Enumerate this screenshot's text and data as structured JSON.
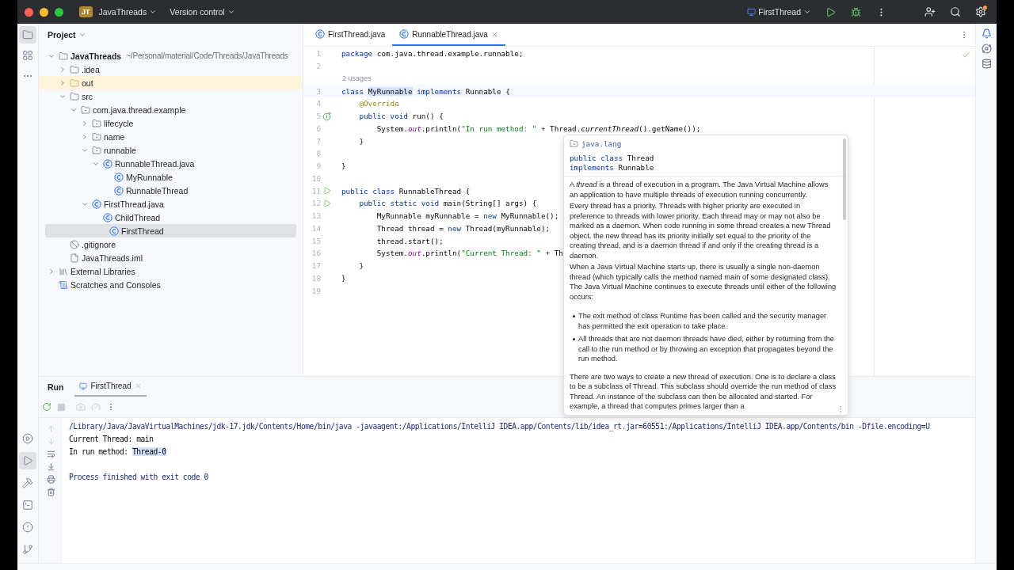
{
  "title_bar": {
    "project_badge": "JT",
    "project": "JavaThreads",
    "vcs": "Version control",
    "run_config": "FirstThread"
  },
  "left_tools": [
    {
      "kind": "project",
      "selected": true
    },
    {
      "kind": "structure",
      "selected": false
    },
    {
      "kind": "more",
      "selected": false
    }
  ],
  "left_tools_bottom": [
    {
      "kind": "services",
      "selected": false
    },
    {
      "kind": "run",
      "selected": true
    },
    {
      "kind": "build",
      "selected": false
    },
    {
      "kind": "terminal",
      "selected": false
    },
    {
      "kind": "problems",
      "selected": false
    },
    {
      "kind": "git",
      "selected": false
    }
  ],
  "project": {
    "title": "Project",
    "tree": [
      {
        "kind": "module",
        "label": "JavaThreads",
        "path": "~/Personal/material/Code/Threads/JavaThreads",
        "expanded": true,
        "selected": false,
        "children": [
          {
            "kind": "folder",
            "label": ".idea",
            "expanded": false,
            "selected": false
          },
          {
            "kind": "excluded-folder",
            "label": "out",
            "expanded": false,
            "selected": false
          },
          {
            "kind": "folder",
            "label": "src",
            "expanded": true,
            "selected": false,
            "children": [
              {
                "kind": "package",
                "label": "com.java.thread.example",
                "expanded": true,
                "selected": false,
                "children": [
                  {
                    "kind": "package",
                    "label": "lifecycle",
                    "expanded": false,
                    "selected": false
                  },
                  {
                    "kind": "package",
                    "label": "name",
                    "expanded": false,
                    "selected": false
                  },
                  {
                    "kind": "package",
                    "label": "runnable",
                    "expanded": true,
                    "selected": false,
                    "children": [
                      {
                        "kind": "class",
                        "label": "RunnableThread.java",
                        "expanded": true,
                        "selected": false,
                        "children": [
                          {
                            "kind": "class",
                            "label": "MyRunnable",
                            "selected": false
                          },
                          {
                            "kind": "class",
                            "label": "RunnableThread",
                            "selected": false
                          }
                        ]
                      }
                    ]
                  },
                  {
                    "kind": "class",
                    "label": "FirstThread.java",
                    "expanded": true,
                    "selected": false,
                    "children": [
                      {
                        "kind": "class",
                        "label": "ChildThread",
                        "selected": false
                      },
                      {
                        "kind": "class",
                        "label": "FirstThread",
                        "selected": true
                      }
                    ]
                  }
                ]
              }
            ]
          },
          {
            "kind": "ignore",
            "label": ".gitignore",
            "selected": false
          },
          {
            "kind": "file",
            "label": "JavaThreads.iml",
            "selected": false
          }
        ]
      },
      {
        "kind": "libraries",
        "label": "External Libraries",
        "expanded": false,
        "selected": false
      },
      {
        "kind": "scratches",
        "label": "Scratches and Consoles",
        "selected": false
      }
    ]
  },
  "editor": {
    "tabs": [
      {
        "label": "FirstThread.java",
        "selected": false
      },
      {
        "label": "RunnableThread.java",
        "selected": true
      }
    ],
    "lines": [
      {
        "kind": "code",
        "number": "1",
        "current": false,
        "segments": [
          {
            "kind": "kw",
            "text": "package"
          },
          {
            "kind": "plain",
            "text": " com.java.thread.example.runnable;"
          }
        ]
      },
      {
        "kind": "code",
        "number": "2",
        "current": false
      },
      {
        "kind": "inlay",
        "text": "2 usages"
      },
      {
        "kind": "code",
        "number": "3",
        "current": true,
        "segments": [
          {
            "kind": "kw",
            "text": "class "
          },
          {
            "kind": "selection",
            "text": "MyRunnable"
          },
          {
            "kind": "kw",
            "text": " implements"
          },
          {
            "kind": "plain",
            "text": " Runnable {"
          }
        ]
      },
      {
        "kind": "code",
        "number": "4",
        "current": false,
        "segments": [
          {
            "kind": "ann",
            "text": "    @Override"
          }
        ]
      },
      {
        "kind": "code",
        "number": "5",
        "current": false,
        "gutter_icon": {
          "kind": "override"
        },
        "segments": [
          {
            "kind": "kw",
            "text": "    public void"
          },
          {
            "kind": "plain",
            "text": " run() {"
          }
        ]
      },
      {
        "kind": "code",
        "number": "6",
        "current": false,
        "segments": [
          {
            "kind": "plain",
            "text": "        System."
          },
          {
            "kind": "field",
            "text": "out"
          },
          {
            "kind": "plain",
            "text": ".println("
          },
          {
            "kind": "str",
            "text": "\"In run method: \""
          },
          {
            "kind": "plain",
            "text": " + Thread."
          },
          {
            "kind": "call",
            "text": "currentThread"
          },
          {
            "kind": "plain",
            "text": "().getName());"
          }
        ]
      },
      {
        "kind": "code",
        "number": "7",
        "current": false,
        "segments": [
          {
            "kind": "plain",
            "text": "    }"
          }
        ]
      },
      {
        "kind": "code",
        "number": "8",
        "current": false
      },
      {
        "kind": "code",
        "number": "9",
        "current": false,
        "segments": [
          {
            "kind": "plain",
            "text": "}"
          }
        ]
      },
      {
        "kind": "code",
        "number": "10",
        "current": false
      },
      {
        "kind": "code",
        "number": "11",
        "current": false,
        "gutter_icon": {
          "kind": "run"
        },
        "segments": [
          {
            "kind": "kw",
            "text": "public class"
          },
          {
            "kind": "plain",
            "text": " RunnableThread {"
          }
        ]
      },
      {
        "kind": "code",
        "number": "12",
        "current": false,
        "gutter_icon": {
          "kind": "run"
        },
        "segments": [
          {
            "kind": "kw",
            "text": "    public static void"
          },
          {
            "kind": "plain",
            "text": " main(String[] args) {"
          }
        ]
      },
      {
        "kind": "code",
        "number": "13",
        "current": false,
        "segments": [
          {
            "kind": "plain",
            "text": "        MyRunnable myRunnable = "
          },
          {
            "kind": "kw",
            "text": "new"
          },
          {
            "kind": "plain",
            "text": " MyRunnable();"
          }
        ]
      },
      {
        "kind": "code",
        "number": "14",
        "current": false,
        "segments": [
          {
            "kind": "plain",
            "text": "        Thread thread = "
          },
          {
            "kind": "kw",
            "text": "new"
          },
          {
            "kind": "plain",
            "text": " Thread(myRunnable);"
          }
        ]
      },
      {
        "kind": "code",
        "number": "15",
        "current": false,
        "segments": [
          {
            "kind": "plain",
            "text": "        thread.start();"
          }
        ]
      },
      {
        "kind": "code",
        "number": "16",
        "current": false,
        "segments": [
          {
            "kind": "plain",
            "text": "        System."
          },
          {
            "kind": "field",
            "text": "out"
          },
          {
            "kind": "plain",
            "text": ".println("
          },
          {
            "kind": "str",
            "text": "\"Current Thread: \""
          },
          {
            "kind": "plain",
            "text": " + Th"
          }
        ]
      },
      {
        "kind": "code",
        "number": "17",
        "current": false,
        "segments": [
          {
            "kind": "plain",
            "text": "    }"
          }
        ]
      },
      {
        "kind": "code",
        "number": "18",
        "current": false,
        "segments": [
          {
            "kind": "plain",
            "text": "}"
          }
        ]
      },
      {
        "kind": "code",
        "number": "19",
        "current": false
      }
    ]
  },
  "doc_popup": {
    "package": "java.lang",
    "signature": [
      [
        {
          "kind": "kw",
          "text": "public class"
        },
        {
          "kind": "plain",
          "text": " Thread"
        }
      ],
      [
        {
          "kind": "kw",
          "text": "implements"
        },
        {
          "kind": "plain",
          "text": " Runnable"
        }
      ]
    ],
    "blocks": [
      {
        "kind": "paragraph",
        "text": "A *thread* is a thread of execution in a program. The Java Virtual Machine allows an application to have multiple threads of execution running concurrently."
      },
      {
        "kind": "paragraph",
        "text": "Every thread has a priority. Threads with higher priority are executed in preference to threads with lower priority. Each thread may or may not also be marked as a daemon. When code running in some thread creates a new Thread object, the new thread has its priority initially set equal to the priority of the creating thread, and is a daemon thread if and only if the creating thread is a daemon."
      },
      {
        "kind": "paragraph",
        "text": "When a Java Virtual Machine starts up, there is usually a single non-daemon thread (which typically calls the method named main of some designated class). The Java Virtual Machine continues to execute threads until either of the following occurs:"
      },
      {
        "kind": "bullet",
        "text": "The exit method of class Runtime has been called and the security manager has permitted the exit operation to take place."
      },
      {
        "kind": "bullet",
        "text": "All threads that are not daemon threads have died, either by returning from the call to the run method or by throwing an exception that propagates beyond the run method."
      },
      {
        "kind": "paragraph",
        "text": "There are two ways to create a new thread of execution. One is to declare a class to be a subclass of Thread. This subclass should override the run method of class Thread. An instance of the subclass can then be allocated and started. For example, a thread that computes primes larger than a"
      }
    ]
  },
  "run": {
    "title": "Run",
    "tabs": [
      {
        "label": "FirstThread",
        "selected": true
      }
    ],
    "console": [
      {
        "segments": [
          {
            "kind": "command",
            "text": "/Library/Java/JavaVirtualMachines/jdk-17.jdk/Contents/Home/bin/java -javaagent:/Applications/IntelliJ IDEA.app/Contents/lib/idea_rt.jar=60551:/Applications/IntelliJ IDEA.app/Contents/bin -Dfile.encoding=U"
          }
        ]
      },
      {
        "segments": [
          {
            "kind": "output",
            "text": "Current Thread: main"
          }
        ]
      },
      {
        "segments": [
          {
            "kind": "output",
            "text": "In run method: "
          },
          {
            "kind": "selection",
            "text": "Thread-0"
          }
        ]
      },
      {
        "kind": "status",
        "segments": [
          {
            "kind": "command",
            "text": "Process finished with exit code 0"
          }
        ]
      }
    ]
  }
}
